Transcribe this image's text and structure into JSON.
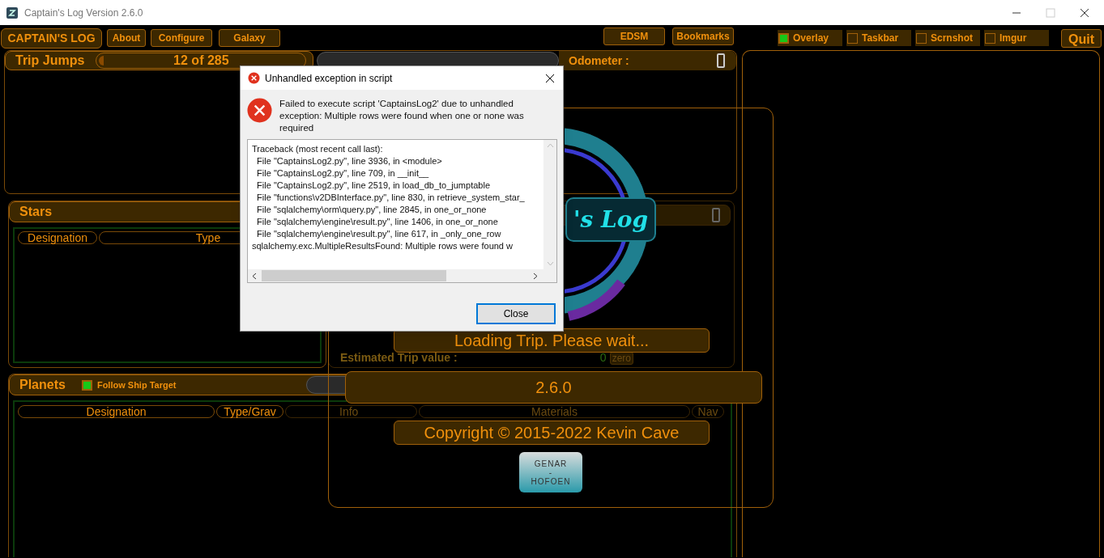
{
  "window": {
    "title": "Captain's Log Version 2.6.0"
  },
  "toolbar": {
    "brand": "CAPTAIN'S LOG",
    "left_buttons": [
      "About",
      "Configure",
      "Galaxy"
    ],
    "right_buttons": [
      "EDSM",
      "Bookmarks"
    ],
    "toggles": [
      {
        "label": "Overlay",
        "checked": true
      },
      {
        "label": "Taskbar",
        "checked": false
      },
      {
        "label": "Scrnshot",
        "checked": false
      },
      {
        "label": "Imgur",
        "checked": false
      }
    ],
    "quit": "Quit"
  },
  "trip_jumps": {
    "title": "Trip Jumps",
    "counter": "12 of 285",
    "level": 0.0,
    "odometer": "Odometer :"
  },
  "stars": {
    "title": "Stars",
    "columns": [
      "Designation",
      "Type"
    ]
  },
  "trip_value": {
    "label": "Estimated Trip value :",
    "value": "0",
    "button": "zero"
  },
  "planets": {
    "title": "Planets",
    "follow": {
      "label": "Follow Ship Target",
      "checked": true
    },
    "columns": [
      "Designation",
      "Type/Grav",
      "Info",
      "Materials",
      "Nav"
    ]
  },
  "splash": {
    "logo": "'s Log",
    "loading": "Loading Trip. Please wait...",
    "version": "2.6.0",
    "copyright": "Copyright © 2015-2022 Kevin Cave",
    "studio": [
      "GENAR",
      "-",
      "HOFOEN"
    ]
  },
  "dialog": {
    "title": "Unhandled exception in script",
    "message": "Failed to execute script 'CaptainsLog2' due to unhandled exception: Multiple rows were found when one or none was required",
    "traceback": [
      "Traceback (most recent call last):",
      "  File \"CaptainsLog2.py\", line 3936, in <module>",
      "  File \"CaptainsLog2.py\", line 709, in __init__",
      "  File \"CaptainsLog2.py\", line 2519, in load_db_to_jumptable",
      "  File \"functions\\v2DBInterface.py\", line 830, in retrieve_system_star_",
      "  File \"sqlalchemy\\orm\\query.py\", line 2845, in one_or_none",
      "  File \"sqlalchemy\\engine\\result.py\", line 1406, in one_or_none",
      "  File \"sqlalchemy\\engine\\result.py\", line 617, in _only_one_row",
      "sqlalchemy.exc.MultipleResultsFound: Multiple rows were found w"
    ],
    "button": "Close"
  }
}
